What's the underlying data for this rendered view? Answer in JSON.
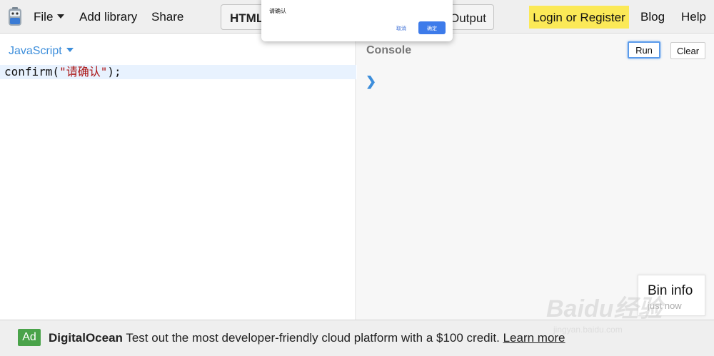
{
  "topbar": {
    "menu": {
      "file": "File",
      "add_library": "Add library",
      "share": "Share"
    },
    "tabs": {
      "html": "HTML",
      "output": "Output"
    },
    "login": "Login or Register",
    "blog": "Blog",
    "help": "Help"
  },
  "editor": {
    "language": "JavaScript",
    "code": {
      "prefix": "confirm(",
      "string": "\"请确认\"",
      "suffix": ");"
    }
  },
  "console": {
    "title": "Console",
    "run": "Run",
    "clear": "Clear",
    "prompt": "❯",
    "bin_info": {
      "title": "Bin info",
      "subtitle": "just now"
    }
  },
  "footer": {
    "ad_badge": "Ad",
    "brand": "DigitalOcean",
    "text": "Test out the most developer-friendly cloud platform with a $100 credit.",
    "learn_more": "Learn more"
  },
  "dialog": {
    "message": "请确认",
    "cancel": "取消",
    "ok": "确定"
  },
  "watermark": {
    "line1": "Baidu经验",
    "line2": "jingyan.baidu.com"
  },
  "colors": {
    "accent_blue": "#3d8edb",
    "login_yellow": "#fbe957",
    "ad_green": "#4aa34a",
    "dialog_ok": "#3d7bea"
  }
}
